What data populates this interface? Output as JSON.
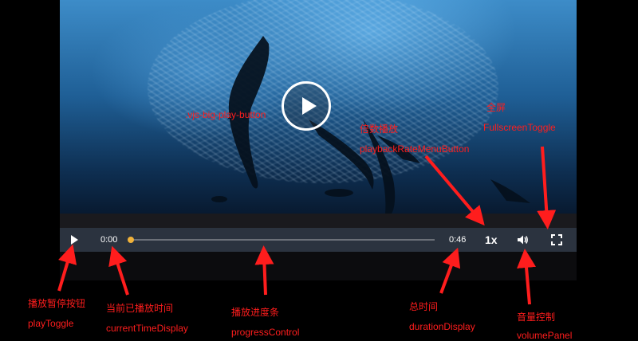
{
  "player": {
    "current_time": "0:00",
    "duration": "0:46",
    "playback_rate": "1x",
    "progress": 0,
    "progress_color": "#f0b23a",
    "controlbar_color": "#2b333f"
  },
  "annotations": {
    "big_play": ".vjs-big-play-button",
    "fullscreen_cn": "全屏",
    "fullscreen_en": "FullscreenToggle",
    "rate_cn": "倍数播放",
    "rate_en": "playbackRateMenuButton",
    "play_cn": "播放暂停按钮",
    "play_en": "playToggle",
    "current_cn": "当前已播放时间",
    "current_en": "currentTimeDisplay",
    "progress_cn": "播放进度条",
    "progress_en": "progressControl",
    "duration_cn": "总时间",
    "duration_en": "durationDisplay",
    "volume_cn": "音量控制",
    "volume_en": "volumePanel",
    "color": "#ff1d1d"
  }
}
